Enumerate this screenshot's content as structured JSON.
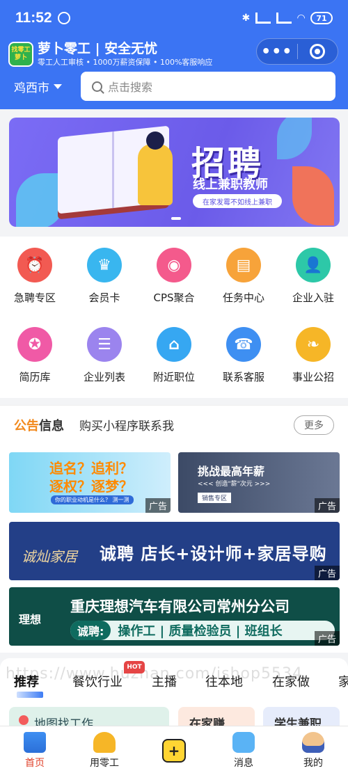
{
  "statusbar": {
    "time": "11:52",
    "battery": "71"
  },
  "app": {
    "logo_top": "找零工",
    "logo_bottom": "萝卜",
    "title": "萝卜零工 | 安全无忧",
    "subtitle": "零工人工审核 • 1000万薪资保障 • 100%客服响应"
  },
  "location": {
    "city": "鸡西市"
  },
  "search": {
    "placeholder": "点击搜索"
  },
  "banner": {
    "title": "招聘",
    "subtitle": "线上兼职教师",
    "pill": "在家发霉不如线上兼职"
  },
  "grid": {
    "items": [
      {
        "label": "急聘专区",
        "icon": "alarm-icon",
        "color": "#f25a52",
        "glyph": "⏰"
      },
      {
        "label": "会员卡",
        "icon": "crown-icon",
        "color": "#39b6ef",
        "glyph": "♛"
      },
      {
        "label": "CPS聚合",
        "icon": "film-icon",
        "color": "#f45a8c",
        "glyph": "◉"
      },
      {
        "label": "任务中心",
        "icon": "book-icon",
        "color": "#f7a33a",
        "glyph": "▤"
      },
      {
        "label": "企业入驻",
        "icon": "user-icon",
        "color": "#2dc8a8",
        "glyph": "👤"
      },
      {
        "label": "简历库",
        "icon": "badge-icon",
        "color": "#f05aa6",
        "glyph": "✪"
      },
      {
        "label": "企业列表",
        "icon": "chat-icon",
        "color": "#9b84ee",
        "glyph": "☰"
      },
      {
        "label": "附近职位",
        "icon": "shop-icon",
        "color": "#36a7f2",
        "glyph": "⌂"
      },
      {
        "label": "联系客服",
        "icon": "phone-icon",
        "color": "#3e8ff2",
        "glyph": "☎"
      },
      {
        "label": "事业公招",
        "icon": "leaf-icon",
        "color": "#f6b627",
        "glyph": "❧"
      }
    ]
  },
  "notice": {
    "label_a": "公告",
    "label_b": "信息",
    "message": "购买小程序联系我",
    "more": "更多"
  },
  "ads": {
    "tag": "广告",
    "ad1_line1a": "追名？",
    "ad1_line1b": "追利？",
    "ad1_line2a": "逐权？",
    "ad1_line2b": "逐梦？",
    "ad1_small": "你的职业动机是什么？ 测一测",
    "ad2_title": "挑战最高年薪",
    "ad2_sub": "<<< 创造\"薪\"次元 >>>",
    "ad2_badge": "销售专区",
    "ad3_logo": "诚灿家居",
    "ad3_text": "诚聘  店长+设计师+家居导购",
    "ad4_logo": "理想",
    "ad4_title": "重庆理想汽车有限公司常州分公司",
    "ad4_badge": "诚聘:",
    "ad4_text": "操作工 | 质量检验员 | 班组长"
  },
  "categories": {
    "items": [
      "推荐",
      "餐饮行业",
      "主播",
      "往本地",
      "在家做",
      "家"
    ],
    "hot_badge": "HOT",
    "watermark": "https://www.huzhan.com/ishop5534"
  },
  "cards": {
    "c1": "地图找工作",
    "c2": "在家赚",
    "c3": "学生兼职"
  },
  "tabbar": {
    "items": [
      {
        "label": "首页",
        "icon": "home-icon"
      },
      {
        "label": "用零工",
        "icon": "worker-icon"
      },
      {
        "label": "+",
        "icon": "plus-icon"
      },
      {
        "label": "消息",
        "icon": "message-icon"
      },
      {
        "label": "我的",
        "icon": "profile-icon"
      }
    ]
  },
  "colors": {
    "primary": "#3b74f3",
    "accent_orange": "#f28a1e",
    "active_tab": "#e0412a"
  }
}
